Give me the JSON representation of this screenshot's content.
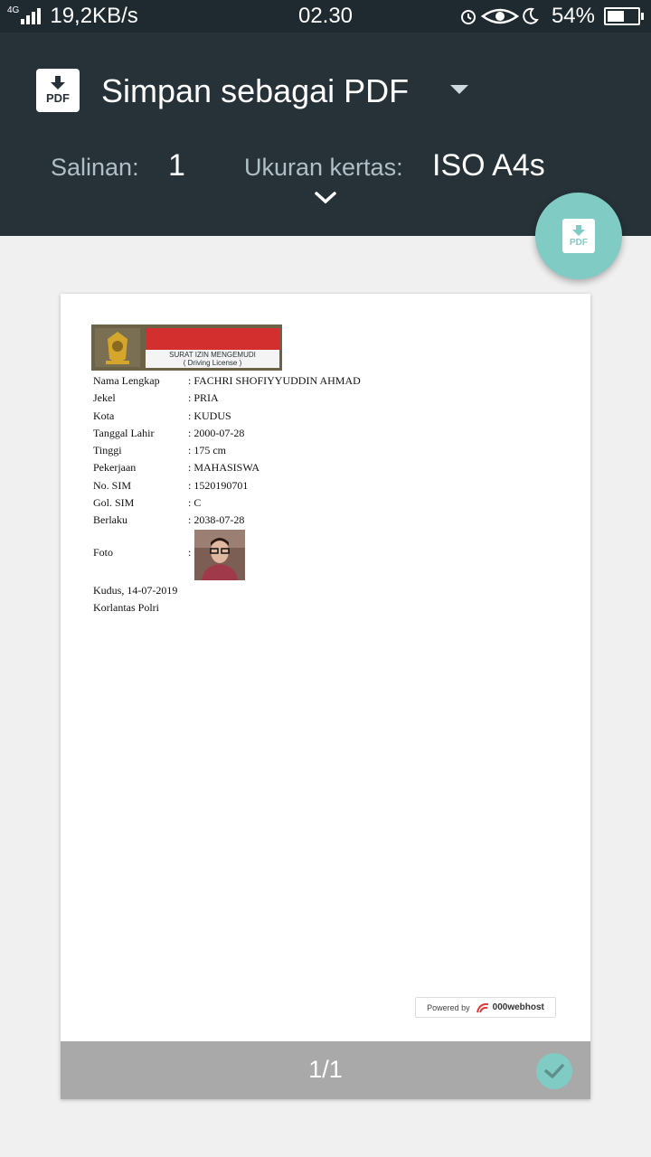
{
  "status": {
    "network": "4G",
    "speed": "19,2KB/s",
    "time": "02.30",
    "battery": "54%",
    "icons": [
      "alarm-icon",
      "eye-icon",
      "moon-icon",
      "battery-icon"
    ]
  },
  "header": {
    "destination": "Simpan sebagai PDF",
    "copies_label": "Salinan:",
    "copies_value": "1",
    "paper_label": "Ukuran kertas:",
    "paper_value": "ISO A4s",
    "icons": [
      "pdf-file-icon",
      "dropdown-caret-icon",
      "chevron-down-icon",
      "save-pdf-icon"
    ]
  },
  "document": {
    "logo_text": "SURAT IZIN MENGEMUDI",
    "logo_subtext": "( Driving License )",
    "fields": [
      {
        "label": "Nama Lengkap",
        "value": ": FACHRI SHOFIYYUDDIN AHMAD"
      },
      {
        "label": "Jekel",
        "value": ": PRIA"
      },
      {
        "label": "Kota",
        "value": ": KUDUS"
      },
      {
        "label": "Tanggal Lahir",
        "value": ": 2000-07-28"
      },
      {
        "label": "Tinggi",
        "value": ": 175 cm"
      },
      {
        "label": "Pekerjaan",
        "value": ": MAHASISWA"
      },
      {
        "label": "No. SIM",
        "value": ": 1520190701"
      },
      {
        "label": "Gol. SIM",
        "value": ": C"
      },
      {
        "label": "Berlaku",
        "value": ": 2038-07-28"
      }
    ],
    "photo_label": "Foto",
    "photo_colon": ":",
    "place_date": "Kudus, 14-07-2019",
    "issuer": "Korlantas Polri",
    "powered_by": "Powered by",
    "powered_brand": "000webhost"
  },
  "preview": {
    "page_indicator": "1/1"
  },
  "colors": {
    "header_bg": "#263238",
    "accent": "#80cbc4",
    "page_bar": "#a9a9a9"
  }
}
